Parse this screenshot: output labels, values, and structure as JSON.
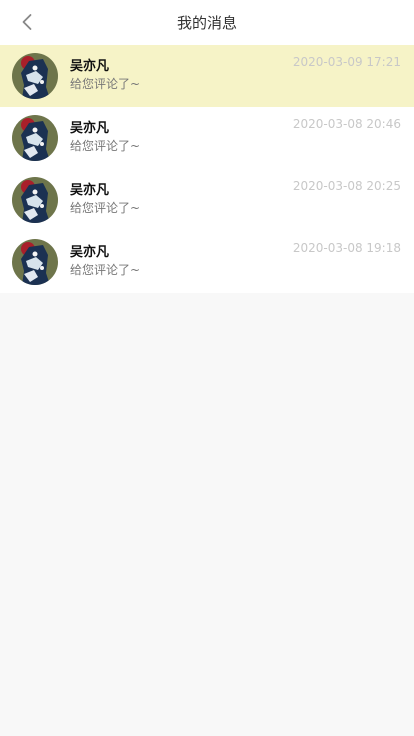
{
  "header": {
    "title": "我的消息"
  },
  "messages": [
    {
      "name": "吴亦凡",
      "text": "给您评论了~",
      "time": "2020-03-09 17:21",
      "highlighted": true
    },
    {
      "name": "吴亦凡",
      "text": "给您评论了~",
      "time": "2020-03-08 20:46",
      "highlighted": false
    },
    {
      "name": "吴亦凡",
      "text": "给您评论了~",
      "time": "2020-03-08 20:25",
      "highlighted": false
    },
    {
      "name": "吴亦凡",
      "text": "给您评论了~",
      "time": "2020-03-08 19:18",
      "highlighted": false
    }
  ],
  "colors": {
    "highlight": "#f6f3c7",
    "background": "#f8f8f8",
    "time": "#c8c8c8"
  }
}
